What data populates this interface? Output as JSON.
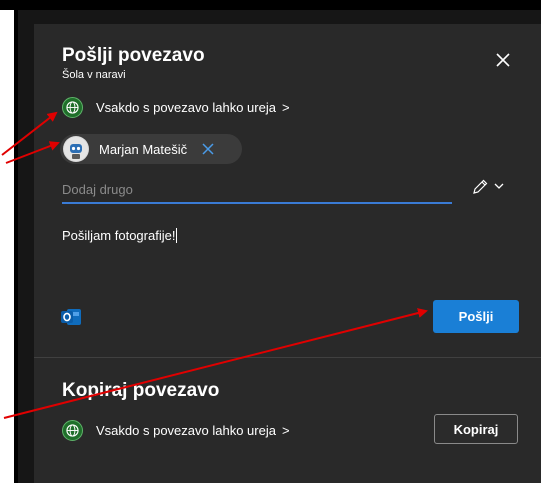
{
  "dialog": {
    "title": "Pošlji povezavo",
    "subtitle": "Šola v naravi",
    "close_icon": "close-icon"
  },
  "send": {
    "permission_label": "Vsakdo s povezavo lahko ureja",
    "permission_chevron": ">",
    "recipient": {
      "name": "Marjan Matešič",
      "avatar_icon": "robot-avatar"
    },
    "add_input": {
      "placeholder": "Dodaj drugo",
      "value": ""
    },
    "message": "Pošiljam fotografije!",
    "outlook_icon": "outlook-icon",
    "send_button": "Pošlji"
  },
  "copy": {
    "title": "Kopiraj povezavo",
    "permission_label": "Vsakdo s povezavo lahko ureja",
    "permission_chevron": ">",
    "copy_button": "Kopiraj"
  },
  "colors": {
    "card": "#292929",
    "accent": "#1a7fd6",
    "annotation_arrow": "#e00000"
  }
}
